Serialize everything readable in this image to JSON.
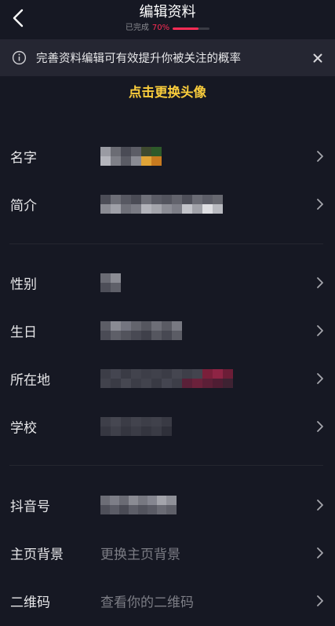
{
  "header": {
    "title": "编辑资料",
    "progress_label": "已完成",
    "progress_value": "70%",
    "progress_fraction": 0.7
  },
  "tip": {
    "text": "完善资料编辑可有效提升你被关注的概率",
    "icon": "info-circle-icon",
    "close_icon": "close-icon"
  },
  "avatar": {
    "change_label": "点击更换头像"
  },
  "sections": [
    {
      "rows": [
        {
          "key": "name",
          "label": "名字",
          "value": ""
        },
        {
          "key": "bio",
          "label": "简介",
          "value": ""
        }
      ]
    },
    {
      "rows": [
        {
          "key": "gender",
          "label": "性别",
          "value": ""
        },
        {
          "key": "birthday",
          "label": "生日",
          "value": ""
        },
        {
          "key": "location",
          "label": "所在地",
          "value": ""
        },
        {
          "key": "school",
          "label": "学校",
          "value": ""
        }
      ]
    },
    {
      "rows": [
        {
          "key": "douyin-id",
          "label": "抖音号",
          "value": ""
        },
        {
          "key": "cover",
          "label": "主页背景",
          "value": "更换主页背景"
        },
        {
          "key": "qrcode",
          "label": "二维码",
          "value": "查看你的二维码"
        }
      ]
    }
  ],
  "colors": {
    "background": "#161823",
    "tip_background": "#252632",
    "accent": "#fe2c55",
    "avatar_link": "#facd3c"
  }
}
